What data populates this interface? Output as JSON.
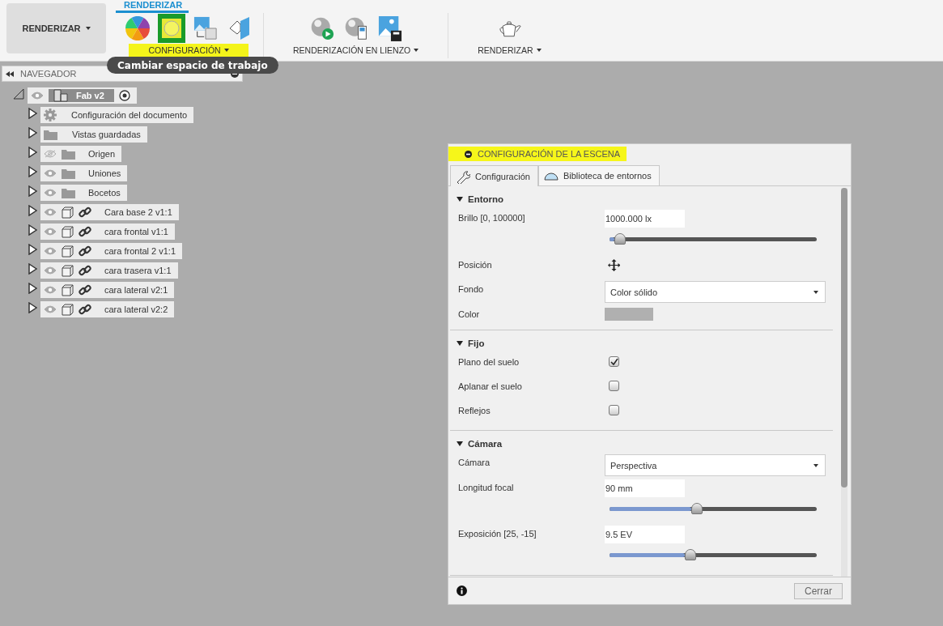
{
  "toolbar": {
    "workspace": {
      "label": "RENDERIZAR"
    },
    "tabs": [
      {
        "label": "RENDERIZAR",
        "selected": true
      }
    ],
    "groups": [
      {
        "label": "CONFIGURACIÓN",
        "highlighted": true,
        "tools": [
          {
            "kind": "wheel",
            "highlighted": false
          },
          {
            "kind": "scene",
            "highlighted": true
          },
          {
            "kind": "texture",
            "highlighted": false
          },
          {
            "kind": "decal",
            "highlighted": false
          }
        ]
      },
      {
        "label": "RENDERIZACIÓN EN LIENZO",
        "highlighted": false,
        "tools": [
          {
            "kind": "play",
            "highlighted": false
          },
          {
            "kind": "settings",
            "highlighted": false
          },
          {
            "kind": "save",
            "highlighted": false
          }
        ]
      },
      {
        "label": "RENDERIZAR",
        "highlighted": false,
        "tools": [
          {
            "kind": "teapot",
            "highlighted": false
          }
        ]
      }
    ]
  },
  "tooltip": "Cambiar espacio de trabajo",
  "navigator": {
    "title": "NAVEGADOR",
    "root": {
      "label": "Fab v2",
      "expanded": true,
      "visible": true,
      "active": true,
      "children": [
        {
          "label": "Configuración del documento",
          "kind": "gear",
          "expanded": false
        },
        {
          "label": "Vistas guardadas",
          "kind": "folder",
          "expanded": false
        },
        {
          "label": "Origen",
          "kind": "folder",
          "expanded": false,
          "visible": false
        },
        {
          "label": "Uniones",
          "kind": "folder",
          "expanded": false,
          "visible": true
        },
        {
          "label": "Bocetos",
          "kind": "folder",
          "expanded": false,
          "visible": true
        },
        {
          "label": "Cara base 2 v1:1",
          "kind": "body",
          "expanded": false,
          "visible": true
        },
        {
          "label": "cara frontal v1:1",
          "kind": "body",
          "expanded": false,
          "visible": true
        },
        {
          "label": "cara frontal 2 v1:1",
          "kind": "body",
          "expanded": false,
          "visible": true
        },
        {
          "label": "cara trasera v1:1",
          "kind": "body",
          "expanded": false,
          "visible": true
        },
        {
          "label": "cara lateral v2:1",
          "kind": "body",
          "expanded": false,
          "visible": true
        },
        {
          "label": "cara lateral v2:2",
          "kind": "body",
          "expanded": false,
          "visible": true
        }
      ]
    }
  },
  "dialog": {
    "title": "CONFIGURACIÓN DE LA ESCENA",
    "highlighted": true,
    "tabs": [
      {
        "label": "Configuración",
        "kind": "wrench",
        "selected": true
      },
      {
        "label": "Biblioteca de entornos",
        "kind": "dome",
        "selected": false
      }
    ],
    "sections": [
      {
        "title": "Entorno",
        "expanded": true,
        "rows": [
          {
            "kind": "slider",
            "label": "Brillo [0, 100000]",
            "value": "1000.000 lx",
            "level": 0.05
          },
          {
            "kind": "move",
            "label": "Posición"
          },
          {
            "kind": "select",
            "label": "Fondo",
            "value": "Color sólido"
          },
          {
            "kind": "swatch",
            "label": "Color",
            "color": "#b0b0b0"
          }
        ]
      },
      {
        "title": "Fijo",
        "expanded": true,
        "rows": [
          {
            "kind": "checkbox",
            "label": "Plano del suelo",
            "checked": true
          },
          {
            "kind": "checkbox",
            "label": "Aplanar el suelo",
            "checked": false
          },
          {
            "kind": "checkbox",
            "label": "Reflejos",
            "checked": false
          }
        ]
      },
      {
        "title": "Cámara",
        "expanded": true,
        "rows": [
          {
            "kind": "select",
            "label": "Cámara",
            "value": "Perspectiva"
          },
          {
            "kind": "slider",
            "label": "Longitud focal",
            "value": "90 mm",
            "level": 0.42
          },
          {
            "kind": "slider",
            "label": "Exposición [25, -15]",
            "value": "9.5 EV",
            "level": 0.39
          }
        ]
      }
    ],
    "close": "Cerrar"
  }
}
